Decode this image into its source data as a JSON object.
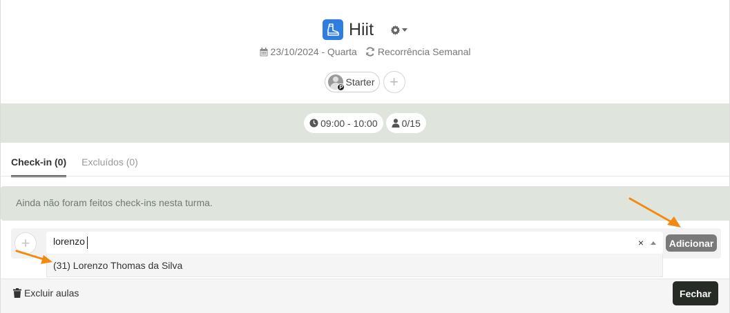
{
  "class_header": {
    "title": "Hiit",
    "app_icon": "boot-icon",
    "settings_icon": "gear-icon",
    "date": "23/10/2024 - Quarta",
    "recurrence": "Recorrência Semanal"
  },
  "plans": {
    "chip_label": "Starter",
    "badge_letter": "P"
  },
  "session": {
    "time_range": "09:00 - 10:00",
    "capacity": "0/15"
  },
  "tabs": [
    {
      "label": "Check-in (0)",
      "active": true
    },
    {
      "label": "Excluídos (0)",
      "active": false
    }
  ],
  "checkins": {
    "empty_message": "Ainda não foram feitos check-ins nesta turma."
  },
  "add_student": {
    "search_value": "lorenzo",
    "clear_label": "×",
    "add_button_label": "Adicionar",
    "options": [
      {
        "label": "(31) Lorenzo Thomas da Silva"
      }
    ]
  },
  "footer": {
    "delete_label": "Excluir aulas",
    "close_label": "Fechar"
  },
  "colors": {
    "accent_blue": "#2f7de1",
    "band_green": "#dfe4dd",
    "dark_button": "#262b26",
    "annotation_arrow": "#f28a12"
  }
}
